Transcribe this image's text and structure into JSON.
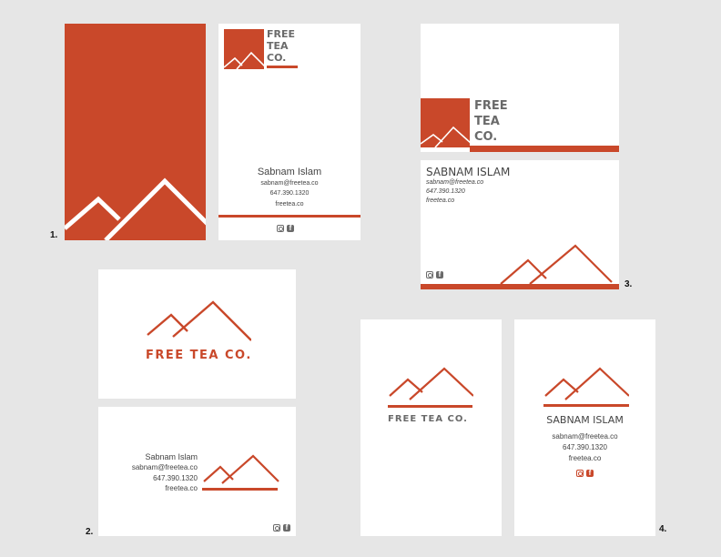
{
  "colors": {
    "accent": "#c9482a",
    "text_grey": "#6a6a6a",
    "background": "#e6e6e6",
    "card": "#ffffff"
  },
  "brand": {
    "line1": "FREE",
    "line2": "TEA",
    "line3": "CO.",
    "full": "FREE TEA CO."
  },
  "contact": {
    "name": "Sabnam Islam",
    "name_caps": "SABNAM ISLAM",
    "email": "sabnam@freetea.co",
    "phone": "647.390.1320",
    "website": "freetea.co"
  },
  "icons": [
    "instagram-icon",
    "facebook-icon",
    "mountain-logo-icon"
  ],
  "labels": {
    "design1": "1.",
    "design2": "2.",
    "design3": "3.",
    "design4": "4."
  }
}
